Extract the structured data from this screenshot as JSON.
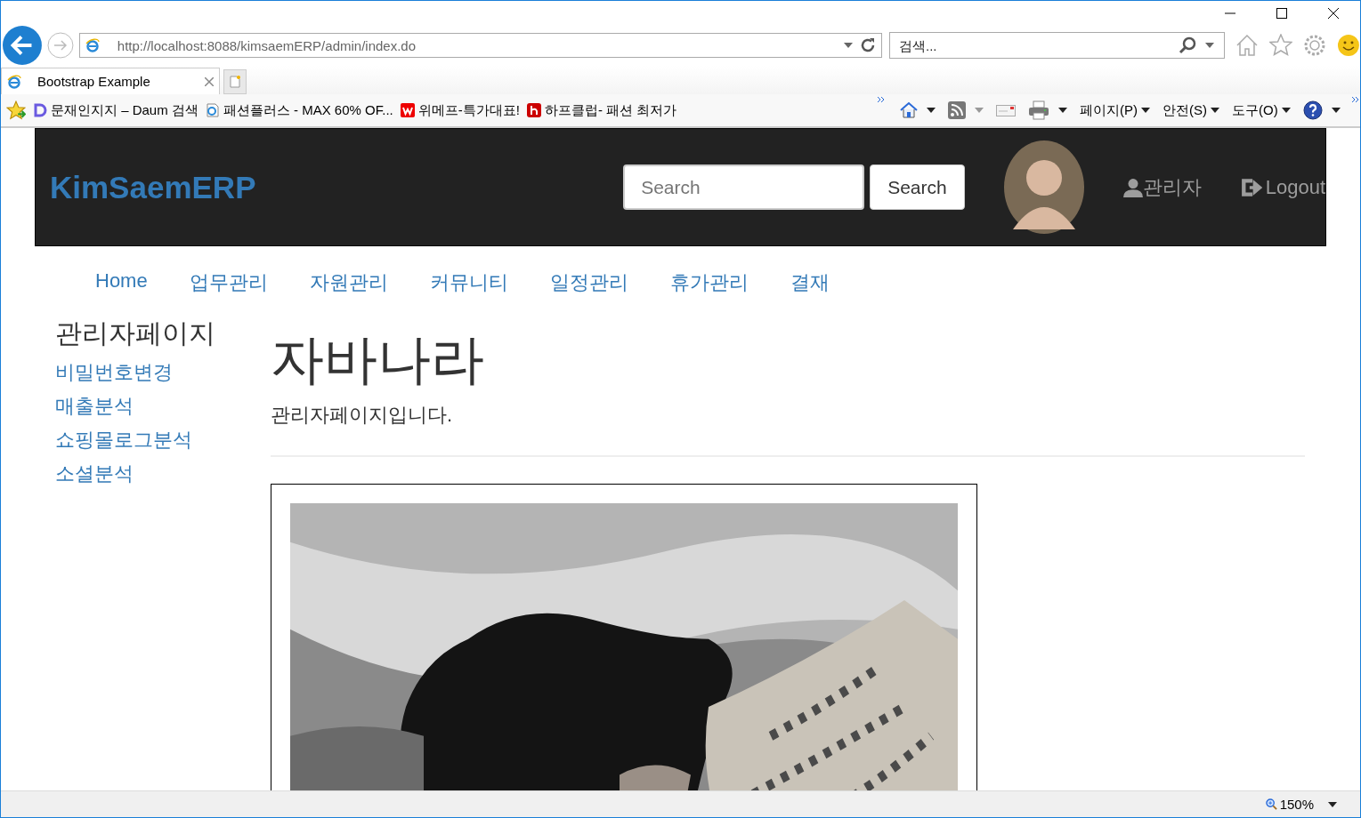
{
  "browser": {
    "address": "http://localhost:8088/kimsaemERP/admin/index.do",
    "search_placeholder": "검색...",
    "tabs": [
      {
        "label": "Bootstrap Example",
        "selected": true
      }
    ],
    "favorites": [
      {
        "kind": "daum",
        "label": "문재인지지 – Daum 검색"
      },
      {
        "kind": "page",
        "label": "패션플러스 - MAX 60% OF..."
      },
      {
        "kind": "w",
        "label": "위메프-특가대표!"
      },
      {
        "kind": "h",
        "label": "하프클럽- 패션 최저가"
      }
    ],
    "commands": [
      {
        "kind": "home"
      },
      {
        "kind": "feed"
      },
      {
        "kind": "mail"
      },
      {
        "kind": "print"
      },
      {
        "kind": "menu",
        "label": "페이지(P)"
      },
      {
        "kind": "menu",
        "label": "안전(S)"
      },
      {
        "kind": "menu",
        "label": "도구(O)"
      },
      {
        "kind": "help"
      }
    ],
    "zoom": "150%"
  },
  "header": {
    "brand": "KimSaemERP",
    "search_placeholder": "Search",
    "search_button": "Search",
    "user": "관리자",
    "logout": "Logout"
  },
  "nav": [
    "Home",
    "업무관리",
    "자원관리",
    "커뮤니티",
    "일정관리",
    "휴가관리",
    "결재"
  ],
  "sidebar": {
    "title": "관리자페이지",
    "links": [
      "비밀번호변경",
      "매출분석",
      "쇼핑몰로그분석",
      "소셜분석"
    ]
  },
  "main": {
    "heading": "자바나라",
    "subtitle": "관리자페이지입니다."
  }
}
